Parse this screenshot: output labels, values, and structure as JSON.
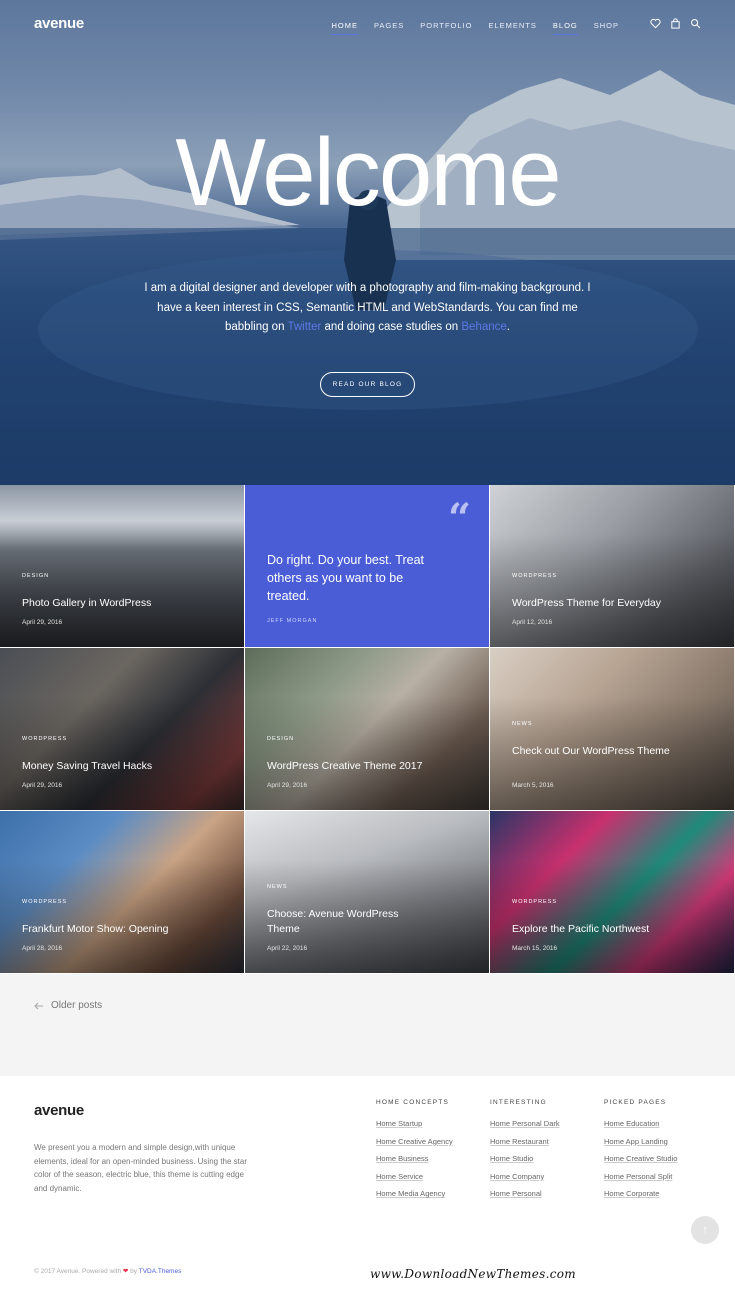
{
  "brand": {
    "logo": "avenue",
    "accent": "#4a5dd6"
  },
  "nav": {
    "items": [
      "HOME",
      "PAGES",
      "PORTFOLIO",
      "ELEMENTS",
      "BLOG",
      "SHOP"
    ],
    "active": [
      "HOME",
      "BLOG"
    ],
    "icons": [
      "heart-icon",
      "bag-icon",
      "search-icon"
    ]
  },
  "hero": {
    "title": "Welcome",
    "text_1": "I am a digital designer and developer with a photography and film-making background. I have a keen interest in CSS, Semantic HTML and WebStandards. You can find me babbling on ",
    "link_1": "Twitter",
    "text_2": " and doing case studies on ",
    "link_2": "Behance",
    "text_3": ".",
    "button": "READ OUR BLOG"
  },
  "posts": [
    {
      "category": "DESIGN",
      "title": "Photo Gallery in WordPress",
      "date": "April 29, 2016"
    },
    {
      "quote": "Do right. Do your best. Treat others as you want to be treated.",
      "author": "JEFF MORGAN"
    },
    {
      "category": "WORDPRESS",
      "title": "WordPress Theme for Everyday",
      "date": "April 12, 2016"
    },
    {
      "category": "WORDPRESS",
      "title": "Money Saving Travel Hacks",
      "date": "April 29, 2016"
    },
    {
      "category": "DESIGN",
      "title": "WordPress Creative Theme 2017",
      "date": "April 29, 2016"
    },
    {
      "category": "NEWS",
      "title": "Check out Our WordPress Theme",
      "date": "March 5, 2016"
    },
    {
      "category": "WORDPRESS",
      "title": "Frankfurt Motor Show: Opening",
      "date": "April 28, 2016"
    },
    {
      "category": "NEWS",
      "title": "Choose: Avenue WordPress Theme",
      "date": "April 22, 2016"
    },
    {
      "category": "WORDPRESS",
      "title": "Explore the Pacific Northwest",
      "date": "March 15, 2016"
    }
  ],
  "pager": {
    "older": "Older posts"
  },
  "footer": {
    "logo": "avenue",
    "description": "We present you a modern and simple design,with unique elements, ideal for an open-minded business. Using the star color of the season, electric blue, this theme is cutting edge and dynamic.",
    "columns": [
      {
        "title": "HOME CONCEPTS",
        "links": [
          "Home Startup",
          "Home Creative Agency",
          "Home Business",
          "Home Service",
          "Home Media Agency"
        ]
      },
      {
        "title": "INTERESTING",
        "links": [
          "Home Personal Dark",
          "Home Restaurant",
          "Home Studio",
          "Home Company",
          "Home Personal"
        ]
      },
      {
        "title": "PICKED PAGES",
        "links": [
          "Home Education",
          "Home App Landing",
          "Home Creative Studio",
          "Home Personal Split",
          "Home Corporate"
        ]
      }
    ],
    "copyright_1": "© 2017 Avenue. Powered with",
    "copyright_heart": "❤",
    "copyright_2": "by",
    "copyright_by": "TVDA.Themes",
    "watermark": "www.DownloadNewThemes.com",
    "to_top": "↑"
  }
}
